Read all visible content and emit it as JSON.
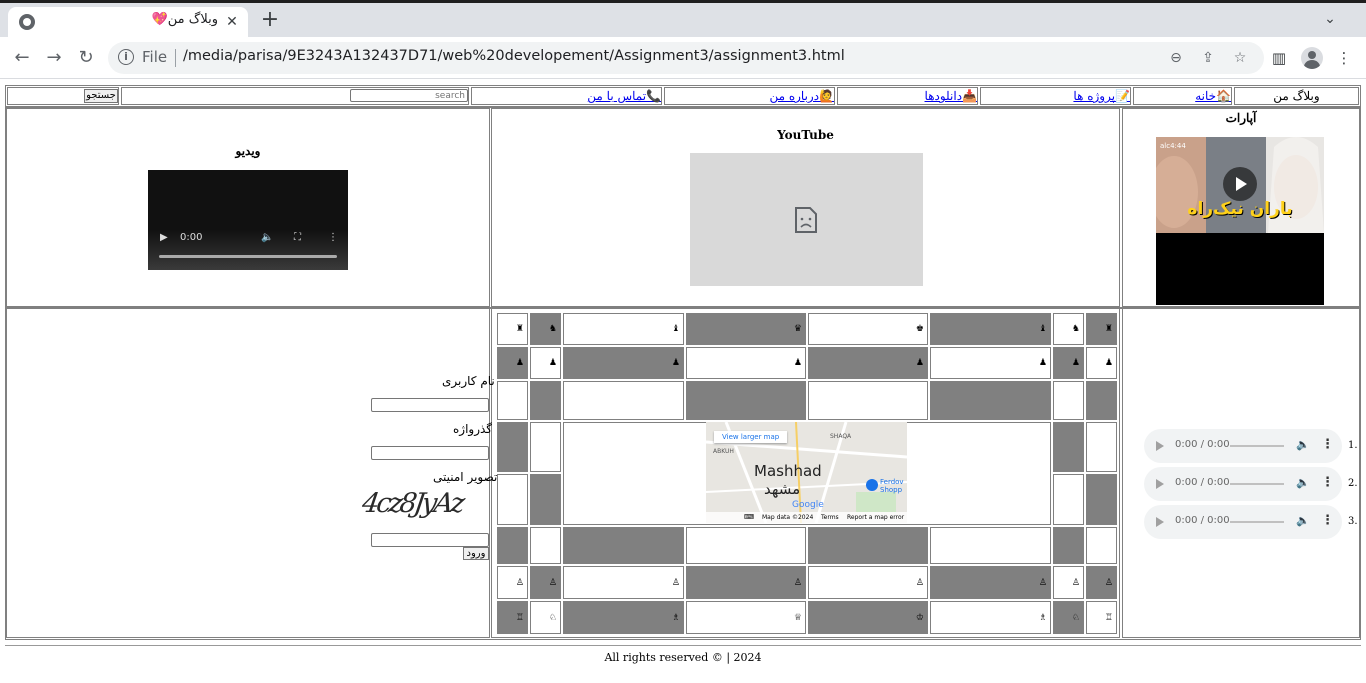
{
  "browser": {
    "tab_title": "وبلاگ من💖",
    "tab_close": "✕",
    "new_tab": "+",
    "tab_search": "⌄",
    "address": {
      "scheme_label": "File",
      "url": "/media/parisa/9E3243A132437D71/web%20developement/Assignment3/assignment3.html"
    },
    "icons": [
      "back-icon",
      "forward-icon",
      "reload-icon",
      "zoom-icon",
      "share-icon",
      "star-icon",
      "sidepanel-icon",
      "profile-icon",
      "menu-icon"
    ]
  },
  "nav": {
    "site_name": "وبلاگ من",
    "home": "🏠خانه",
    "projects": "📝پروژه ها",
    "downloads": "📥دانلودها",
    "about": "🙋درباره من",
    "contact": "📞تماس با من",
    "search_placeholder": "search",
    "search_button": "جستجو"
  },
  "media": {
    "aparat_title": "آپارات",
    "aparat_thumb_text": "باران نیک‌راه",
    "youtube_title": "YouTube",
    "video_title": "ویدیو",
    "video_time": "0:00"
  },
  "map": {
    "city": "Mashhad",
    "city_fa": "مشهد",
    "larger_map": "View larger map",
    "district_1": "SHAQA",
    "district_2": "ABKUH",
    "poi": "Ferdov Shopp",
    "brand": "Google",
    "attribution": "Map data ©2024",
    "terms": "Terms",
    "report": "Report a map error"
  },
  "login": {
    "username_label": "نام کاربری",
    "password_label": "گذرواژه",
    "captcha_label": "تصویر امنیتی",
    "captcha_text": "4cz8JyAz",
    "submit": "ورود"
  },
  "audio": {
    "items": [
      {
        "num": "1.",
        "time": "0:00 / 0:00"
      },
      {
        "num": "2.",
        "time": "0:00 / 0:00"
      },
      {
        "num": "3.",
        "time": "0:00 / 0:00"
      }
    ]
  },
  "chess": {
    "rows": [
      [
        "♜",
        "♞",
        "♝",
        "♚",
        "♛",
        "♝",
        "♞",
        "♜"
      ],
      [
        "♟",
        "♟",
        "♟",
        "♟",
        "♟",
        "♟",
        "♟",
        "♟"
      ],
      [
        "♙",
        "♙",
        "♙",
        "♙",
        "♙",
        "♙",
        "♙",
        "♙"
      ],
      [
        "♖",
        "♘",
        "♗",
        "♔",
        "♕",
        "♗",
        "♘",
        "♖"
      ]
    ]
  },
  "footer": {
    "text": "All rights reserved © | 2024"
  }
}
